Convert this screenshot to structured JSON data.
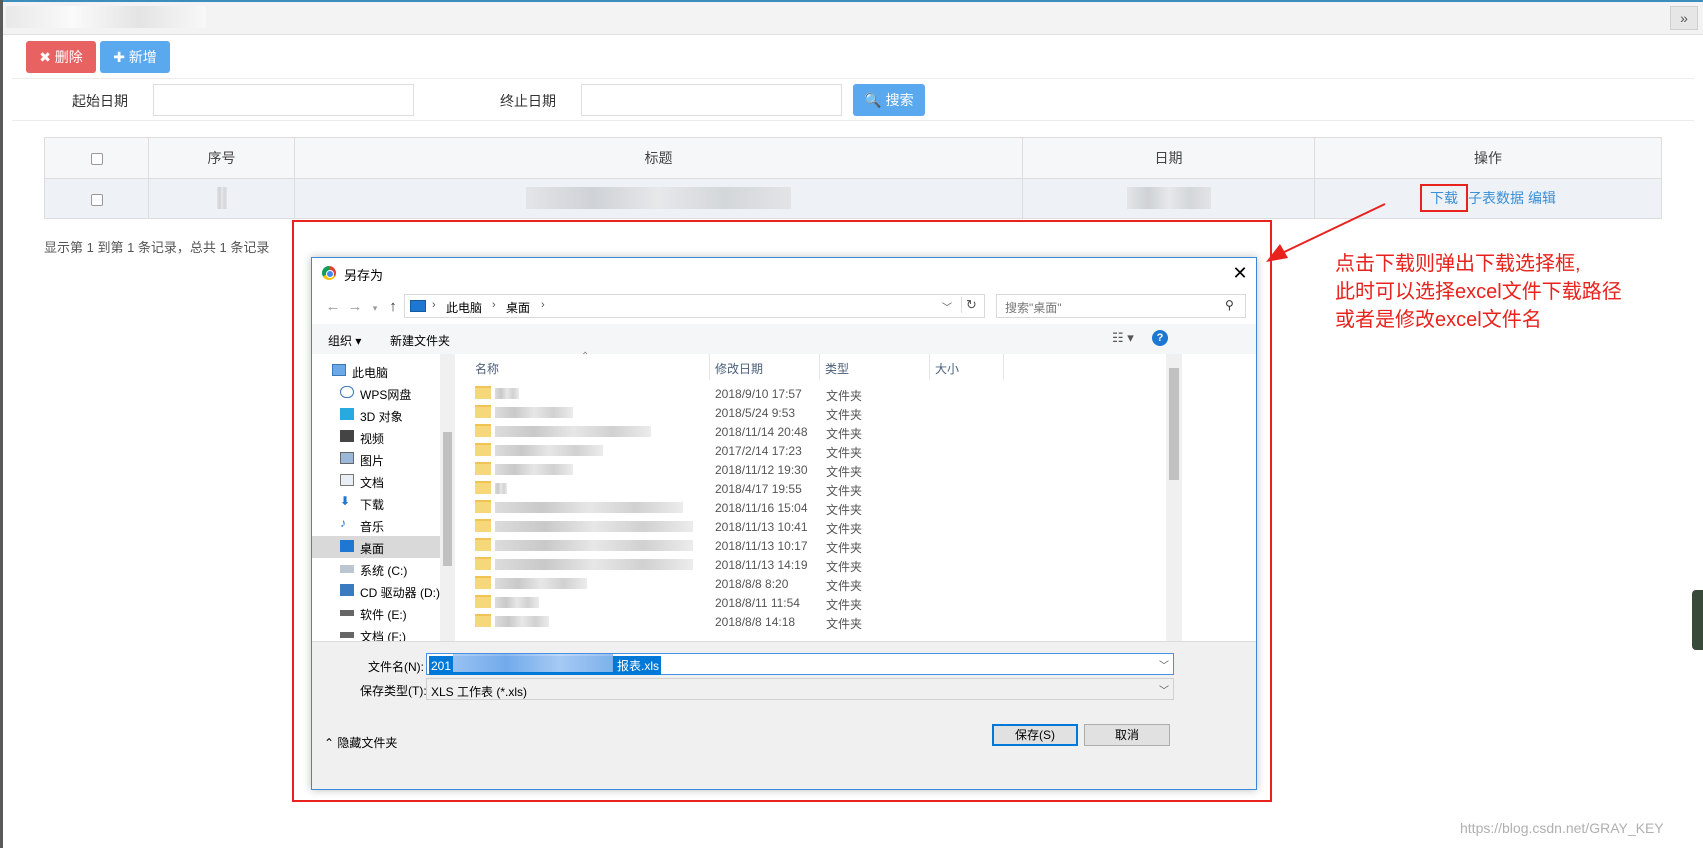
{
  "toolbar": {
    "delete_label": "✖ 删除",
    "add_label": "✚ 新增"
  },
  "search": {
    "start_label": "起始日期",
    "end_label": "终止日期",
    "search_label": "🔍 搜索"
  },
  "table": {
    "headers": [
      "序号",
      "标题",
      "日期",
      "操作"
    ],
    "row_actions": {
      "download": "下载",
      "subtable": "子表数据",
      "edit": "编辑"
    }
  },
  "pager": {
    "text": "显示第 1 到第 1 条记录，总共 1 条记录"
  },
  "annotation": {
    "line1": "点击下载则弹出下载选择框,",
    "line2": "此时可以选择excel文件下载路径",
    "line3": "或者是修改excel文件名"
  },
  "watermark": "https://blog.csdn.net/GRAY_KEY",
  "dialog": {
    "title": "另存为",
    "close": "✕",
    "address": {
      "pc": "此电脑",
      "desktop": "桌面"
    },
    "search_placeholder": "搜索\"桌面\"",
    "cmd": {
      "organize": "组织 ▾",
      "new_folder": "新建文件夹",
      "help": "?"
    },
    "nav_items": [
      {
        "label": "此电脑"
      },
      {
        "label": "WPS网盘"
      },
      {
        "label": "3D 对象"
      },
      {
        "label": "视频"
      },
      {
        "label": "图片"
      },
      {
        "label": "文档"
      },
      {
        "label": "下载"
      },
      {
        "label": "音乐"
      },
      {
        "label": "桌面"
      },
      {
        "label": "系统 (C:)"
      },
      {
        "label": "CD 驱动器 (D:)"
      },
      {
        "label": "软件 (E:)"
      },
      {
        "label": "文档 (F:)"
      }
    ],
    "columns": {
      "name": "名称",
      "modified": "修改日期",
      "type": "类型",
      "size": "大小"
    },
    "files": [
      {
        "date": "2018/9/10 17:57",
        "type": "文件夹"
      },
      {
        "date": "2018/5/24 9:53",
        "type": "文件夹"
      },
      {
        "date": "2018/11/14 20:48",
        "type": "文件夹"
      },
      {
        "date": "2017/2/14 17:23",
        "type": "文件夹"
      },
      {
        "date": "2018/11/12 19:30",
        "type": "文件夹"
      },
      {
        "date": "2018/4/17 19:55",
        "type": "文件夹"
      },
      {
        "date": "2018/11/16 15:04",
        "type": "文件夹"
      },
      {
        "date": "2018/11/13 10:41",
        "type": "文件夹"
      },
      {
        "date": "2018/11/13 10:17",
        "type": "文件夹"
      },
      {
        "date": "2018/11/13 14:19",
        "type": "文件夹"
      },
      {
        "date": "2018/8/8 8:20",
        "type": "文件夹"
      },
      {
        "date": "2018/8/11 11:54",
        "type": "文件夹"
      },
      {
        "date": "2018/8/8 14:18",
        "type": "文件夹"
      }
    ],
    "filename_label": "文件名(N):",
    "filename_prefix": "201",
    "filename_suffix": "报表.xls",
    "filetype_label": "保存类型(T):",
    "filetype_value": "XLS 工作表 (*.xls)",
    "hide_folders": "⌃ 隐藏文件夹",
    "save_label": "保存(S)",
    "cancel_label": "取消"
  }
}
